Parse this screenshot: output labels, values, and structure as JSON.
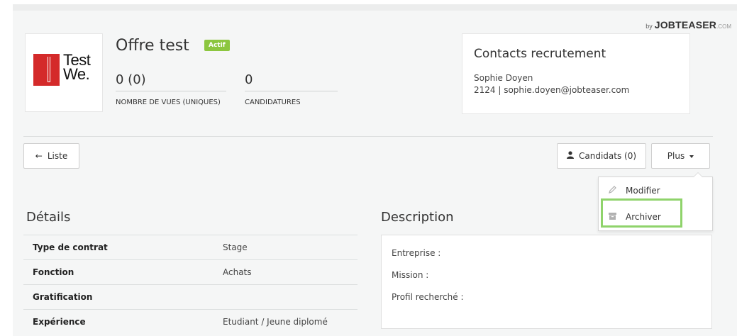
{
  "brand": {
    "by": "by",
    "name": "JOBTEASER",
    "com": ".COM"
  },
  "offer": {
    "title": "Offre test",
    "status_badge": "Actif",
    "logo_text_line1": "Test",
    "logo_text_line2": "We."
  },
  "stats": [
    {
      "value": "0 (0)",
      "label": "NOMBRE DE VUES (UNIQUES)"
    },
    {
      "value": "0",
      "label": "CANDIDATURES"
    }
  ],
  "contacts": {
    "title": "Contacts recrutement",
    "name": "Sophie Doyen",
    "details": "2124 | sophie.doyen@jobteaser.com"
  },
  "toolbar": {
    "back_label": "Liste",
    "candidates_label": "Candidats (0)",
    "more_label": "Plus"
  },
  "dropdown": {
    "items": [
      {
        "label": "Modifier",
        "icon": "pencil-icon"
      },
      {
        "label": "Archiver",
        "icon": "archive-icon"
      }
    ],
    "highlight_color": "#8fd36b"
  },
  "details": {
    "title": "Détails",
    "rows": [
      {
        "key": "Type de contrat",
        "value": "Stage"
      },
      {
        "key": "Fonction",
        "value": "Achats"
      },
      {
        "key": "Gratification",
        "value": ""
      },
      {
        "key": "Expérience",
        "value": "Etudiant / Jeune diplomé"
      }
    ]
  },
  "description": {
    "title": "Description",
    "fields": [
      "Entreprise :",
      "Mission :",
      "Profil recherché :"
    ]
  },
  "colors": {
    "badge": "#8cc63f",
    "logo_red": "#d42a2a",
    "panel_bg": "#f5f6f6"
  }
}
